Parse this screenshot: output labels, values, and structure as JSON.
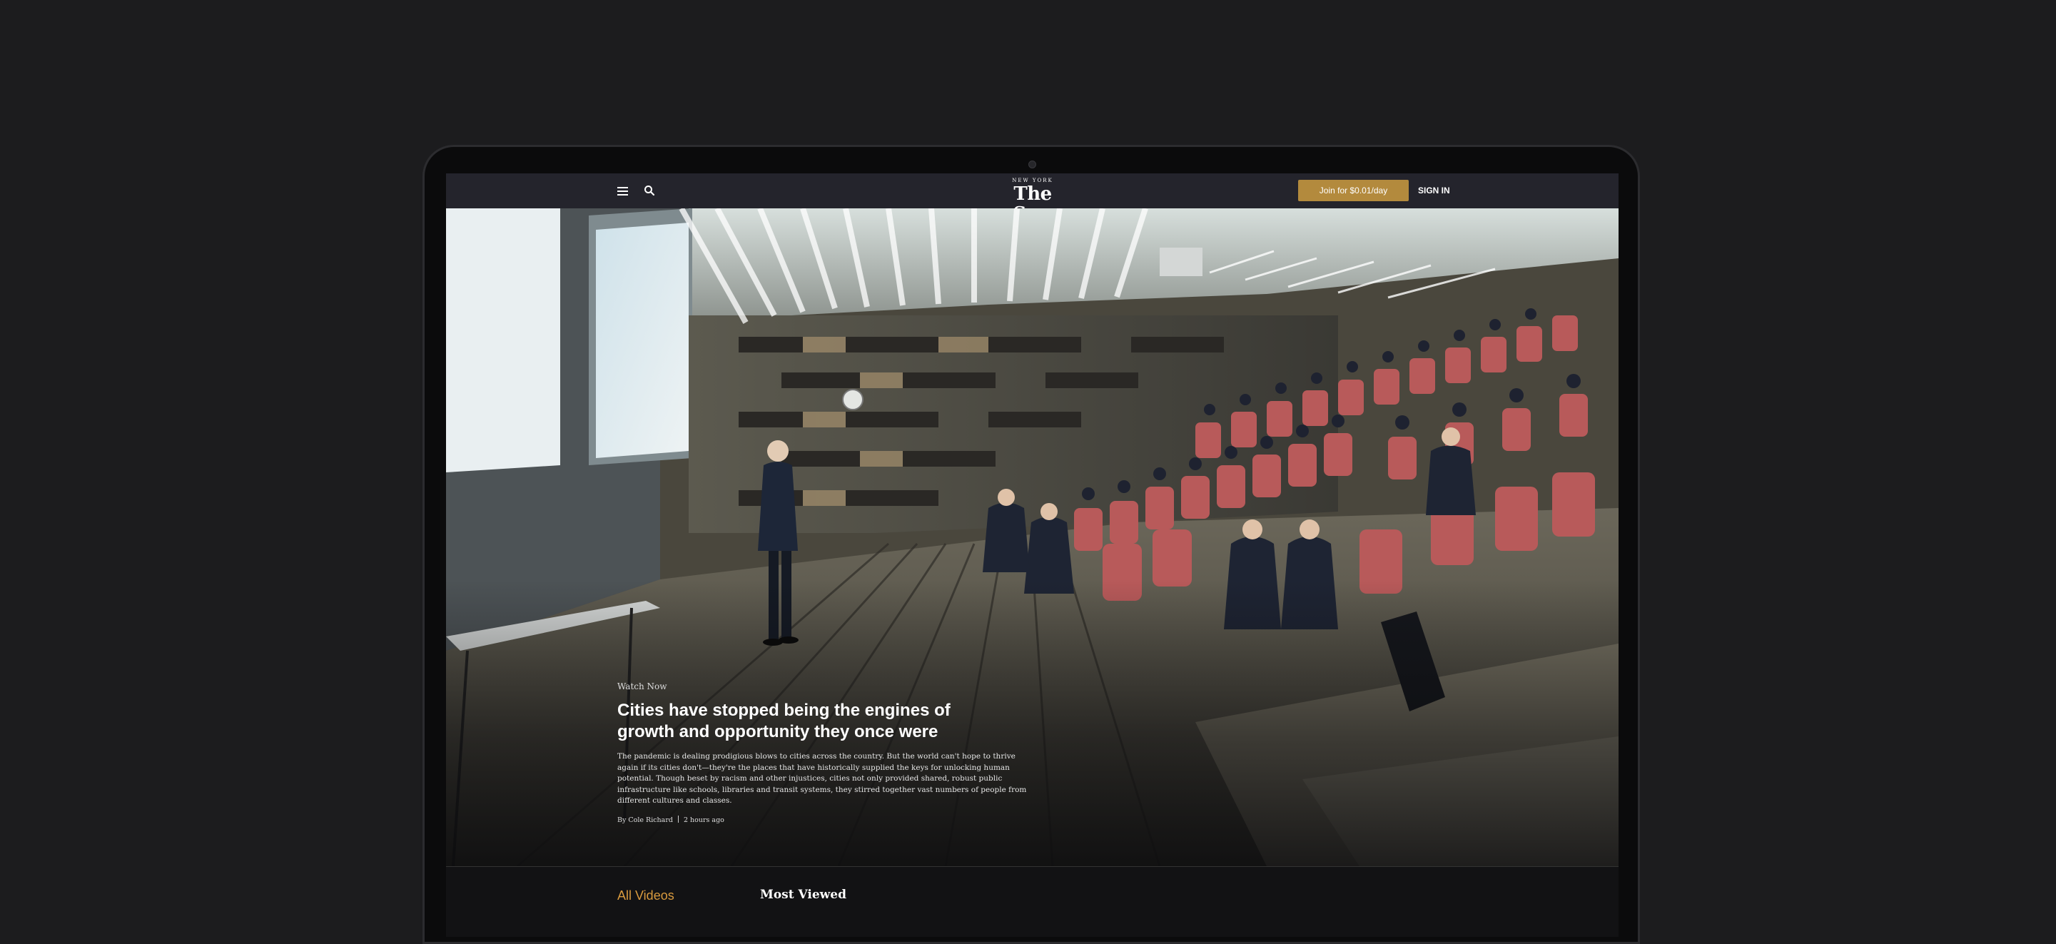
{
  "header": {
    "logo_small": "NEW YORK",
    "logo_main": "The Sun",
    "join_label": "Join for $0.01/day",
    "signin_label": "SIGN IN",
    "menu_icon": "hamburger-menu-icon",
    "search_icon": "search-icon"
  },
  "hero": {
    "eyebrow": "Watch Now",
    "headline": "Cities have stopped being the engines of growth and opportunity they once were",
    "dek": "The pandemic is dealing prodigious blows to cities across the country. But the world can't hope to thrive again if its cities don't—they're the places that have historically supplied the keys for unlocking human potential. Though beset by racism and other injustices, cities not only provided shared, robust public infrastructure like schools, libraries and transit systems, they stirred together vast numbers of people from different cultures and classes.",
    "author": "By Cole Richard",
    "time": "2 hours ago"
  },
  "tabs": {
    "all_videos": "All Videos",
    "most_viewed": "Most Viewed"
  },
  "colors": {
    "accent": "#b38a3d",
    "tab_active": "#d89a3e",
    "topbar": "#24242c"
  }
}
